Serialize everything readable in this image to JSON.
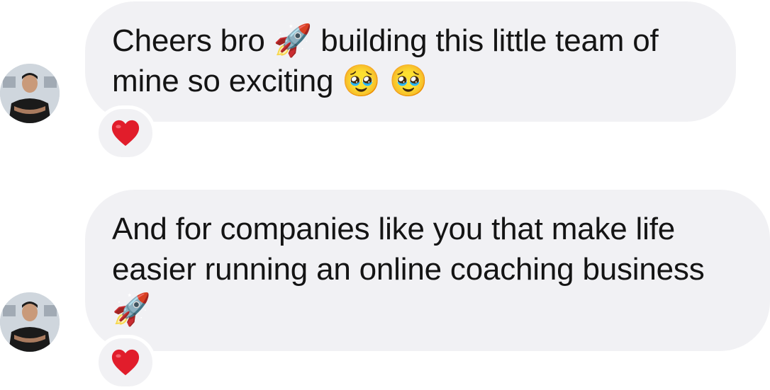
{
  "messages": [
    {
      "text": "Cheers bro 🚀 building this little team of mine so exciting 🥹 🥹",
      "reaction": "red-heart"
    },
    {
      "text": "And for companies like you that make life easier running an online coaching business 🚀",
      "reaction": "red-heart"
    }
  ],
  "avatar_icon": "profile-photo-icon",
  "colors": {
    "bubble_bg": "#f1f1f4",
    "text": "#141414",
    "heart": "#e11d2b"
  }
}
